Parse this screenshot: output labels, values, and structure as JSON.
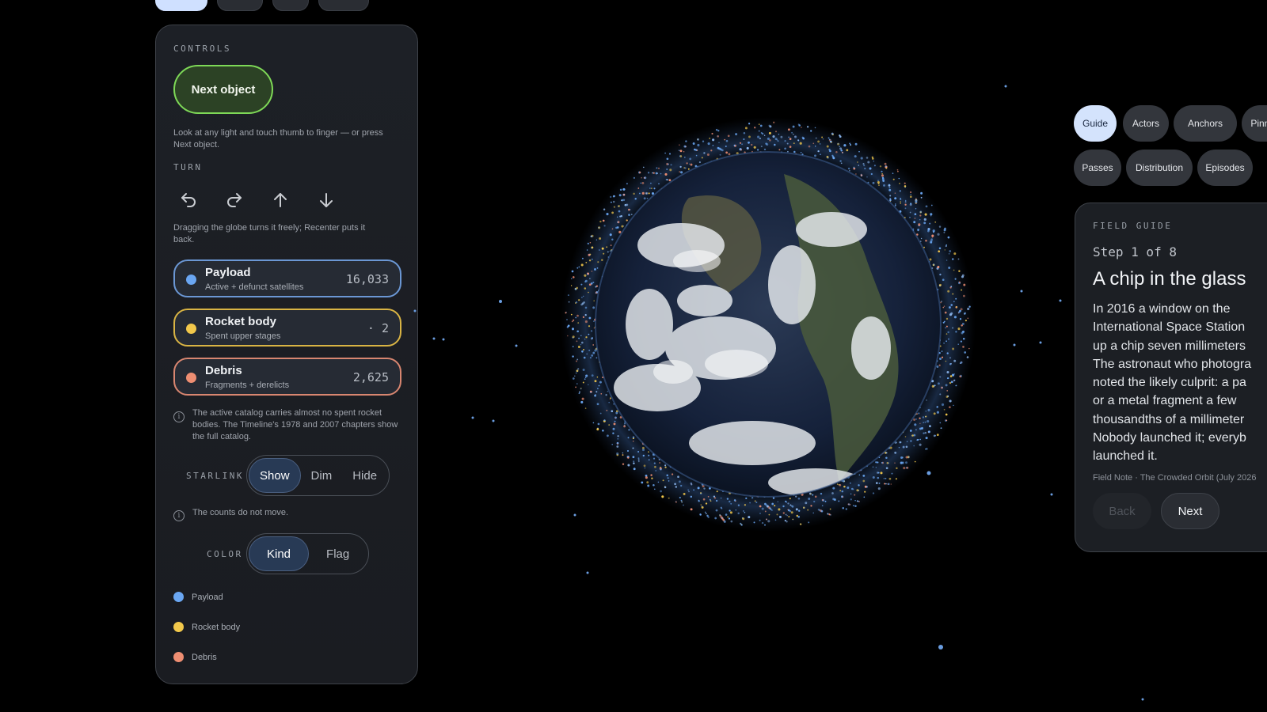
{
  "controls": {
    "section_label": "CONTROLS",
    "next_button": "Next object",
    "next_help": "Look at any light and touch thumb to finger — or press Next object.",
    "turn_label": "TURN",
    "turn_buttons": [
      "turn-left-icon",
      "turn-right-icon",
      "arrow-up-icon",
      "arrow-down-icon"
    ],
    "turn_help": "Dragging the globe turns it freely; Recenter puts it back.",
    "kinds": [
      {
        "name": "Payload",
        "sub": "Active + defunct satellites",
        "count": "16,033",
        "color": "#6aa6f2"
      },
      {
        "name": "Rocket body",
        "sub": "Spent upper stages",
        "count": "2",
        "color": "#f2c84b"
      },
      {
        "name": "Debris",
        "sub": "Fragments + derelicts",
        "count": "2,625",
        "color": "#ee8e72"
      }
    ],
    "catalog_note": "The active catalog carries almost no spent rocket bodies. The Timeline's 1978 and 2007 chapters show the full catalog.",
    "starlink_label": "STARLINK",
    "starlink_options": [
      "Show",
      "Dim",
      "Hide"
    ],
    "starlink_selected": "Show",
    "counts_note": "The counts do not move.",
    "color_label": "COLOR",
    "color_options": [
      "Kind",
      "Flag"
    ],
    "color_selected": "Kind",
    "legend": [
      {
        "label": "Payload",
        "color": "#6aa6f2"
      },
      {
        "label": "Rocket body",
        "color": "#f2c84b"
      },
      {
        "label": "Debris",
        "color": "#ee8e72"
      }
    ]
  },
  "chips": {
    "row1": [
      "Guide",
      "Actors",
      "Anchors",
      "Pinned"
    ],
    "row2": [
      "Passes",
      "Distribution",
      "Episodes"
    ],
    "active": "Guide"
  },
  "guide": {
    "label": "FIELD GUIDE",
    "step": "Step 1 of 8",
    "title": "A chip in the glass",
    "body_lines": [
      "In 2016 a window on the",
      "International Space Station",
      "up a chip seven millimeters",
      "The astronaut who photogra",
      "noted the likely culprit: a pa",
      "or a metal fragment a few",
      "thousandths of a millimeter",
      "Nobody launched it; everyb",
      "launched it."
    ],
    "note": "Field Note · The Crowded Orbit (July 2026",
    "back": "Back",
    "next": "Next"
  },
  "colors": {
    "accent_green": "#7ed957",
    "selected_blue": "#283a55",
    "background": "#000000"
  }
}
